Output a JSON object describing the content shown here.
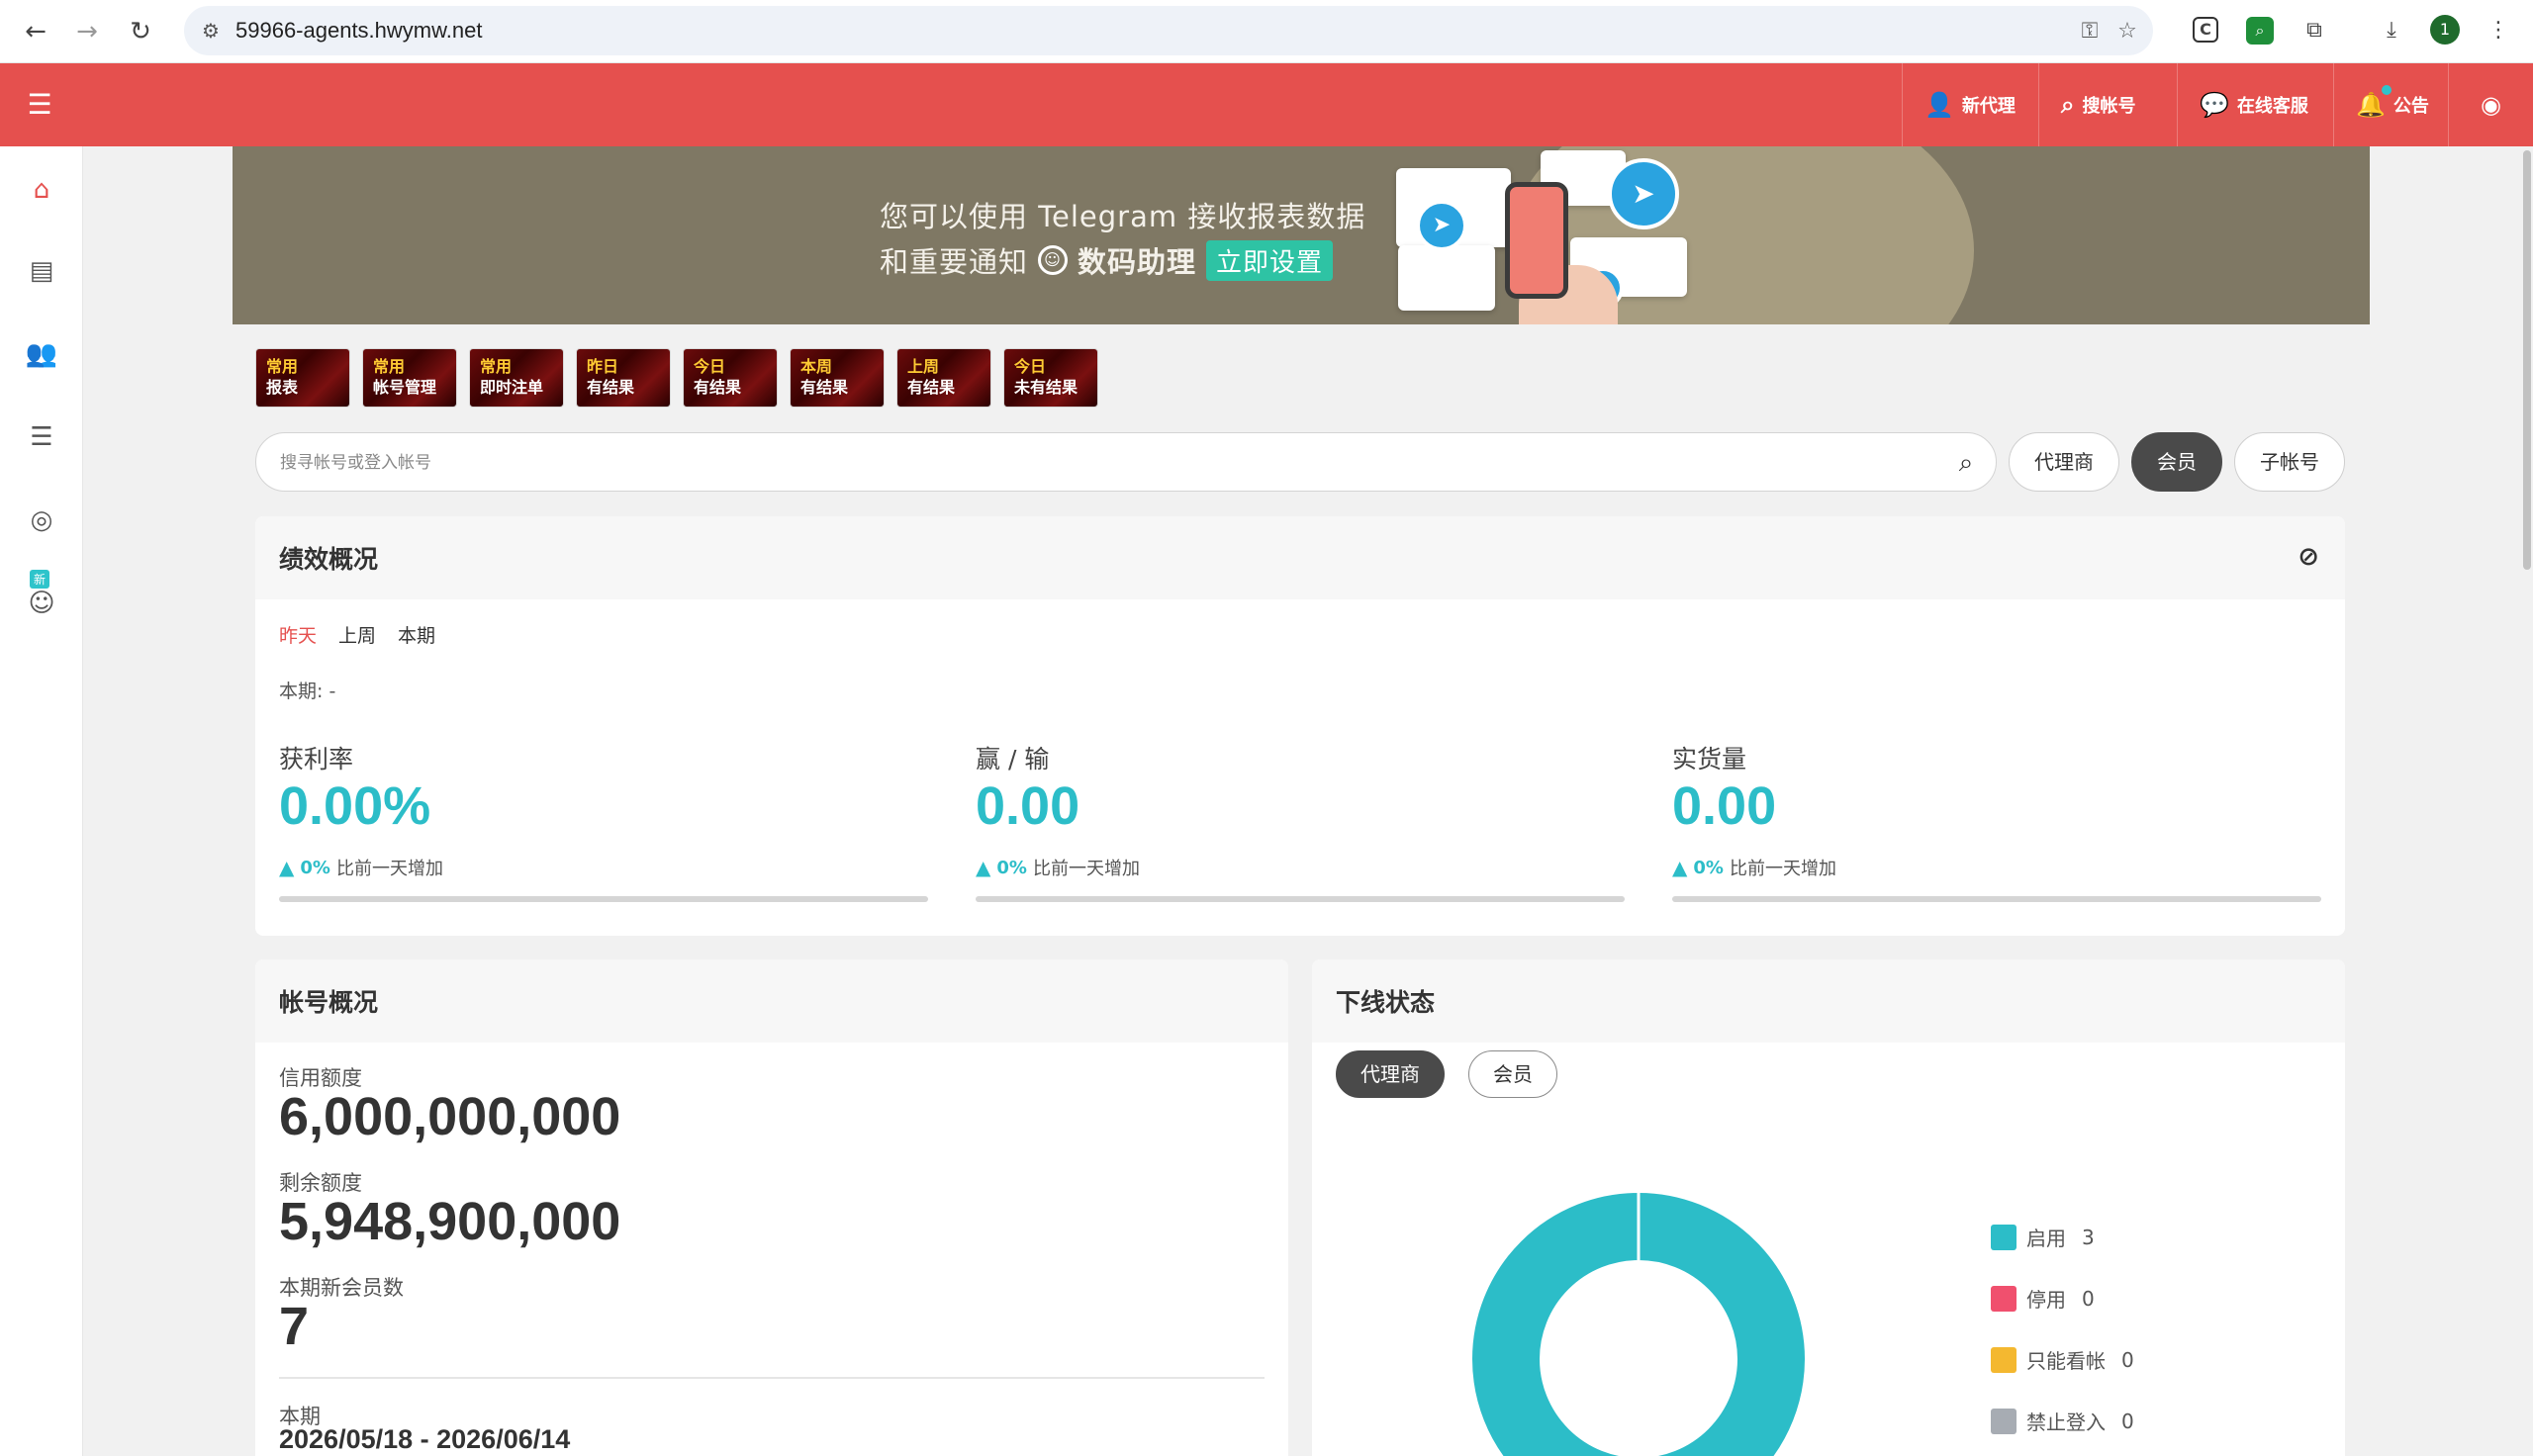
{
  "browser": {
    "url": "59966-agents.hwymw.net",
    "profile_letter": "1"
  },
  "header": {
    "buttons": [
      {
        "label": "新代理",
        "icon": "user-plus-icon"
      },
      {
        "label": "搜帐号",
        "icon": "search-icon"
      },
      {
        "label": "在线客服",
        "icon": "chat-icon"
      },
      {
        "label": "公告",
        "icon": "bell-icon"
      }
    ]
  },
  "banner": {
    "line1": "您可以使用 Telegram 接收报表数据",
    "line2_prefix": "和重要通知",
    "brand": "数码助理",
    "setup": "立即设置"
  },
  "sidebar": {
    "new_badge": "新"
  },
  "quick_buttons": [
    {
      "top": "常用",
      "bottom": "报表"
    },
    {
      "top": "常用",
      "bottom": "帐号管理"
    },
    {
      "top": "常用",
      "bottom": "即时注单"
    },
    {
      "top": "昨日",
      "bottom": "有结果"
    },
    {
      "top": "今日",
      "bottom": "有结果"
    },
    {
      "top": "本周",
      "bottom": "有结果"
    },
    {
      "top": "上周",
      "bottom": "有结果"
    },
    {
      "top": "今日",
      "bottom": "未有结果"
    }
  ],
  "search": {
    "placeholder": "搜寻帐号或登入帐号",
    "filters": [
      "代理商",
      "会员",
      "子帐号"
    ],
    "active_filter": "会员"
  },
  "performance": {
    "title": "绩效概况",
    "tabs": [
      "昨天",
      "上周",
      "本期"
    ],
    "active_tab": "昨天",
    "period": "本期: -",
    "metrics": [
      {
        "label": "获利率",
        "value": "0.00%",
        "pct": "0%",
        "text": "比前一天增加"
      },
      {
        "label": "赢 / 输",
        "value": "0.00",
        "pct": "0%",
        "text": "比前一天增加"
      },
      {
        "label": "实货量",
        "value": "0.00",
        "pct": "0%",
        "text": "比前一天增加"
      }
    ]
  },
  "account": {
    "title": "帐号概况",
    "credit_label": "信用额度",
    "credit_value": "6,000,000,000",
    "remaining_label": "剩余额度",
    "remaining_value": "5,948,900,000",
    "new_members_label": "本期新会员数",
    "new_members_value": "7",
    "period_label": "本期",
    "period_dates": "2026/05/18 - 2026/06/14"
  },
  "downline": {
    "title": "下线状态",
    "tabs": [
      "代理商",
      "会员"
    ],
    "active_tab": "代理商",
    "legend": [
      {
        "label": "启用",
        "count": "3",
        "color": "#2cbdc8"
      },
      {
        "label": "停用",
        "count": "0",
        "color": "#f0506e"
      },
      {
        "label": "只能看帐",
        "count": "0",
        "color": "#f4b830"
      },
      {
        "label": "禁止登入",
        "count": "0",
        "color": "#a7acb3"
      }
    ]
  },
  "chart_data": {
    "type": "pie",
    "categories": [
      "启用",
      "停用",
      "只能看帐",
      "禁止登入"
    ],
    "values": [
      3,
      0,
      0,
      0
    ],
    "colors": [
      "#2cbdc8",
      "#f0506e",
      "#f4b830",
      "#a7acb3"
    ]
  },
  "colors": {
    "brand_red": "#e5504e",
    "accent_teal": "#2cbdc8"
  }
}
